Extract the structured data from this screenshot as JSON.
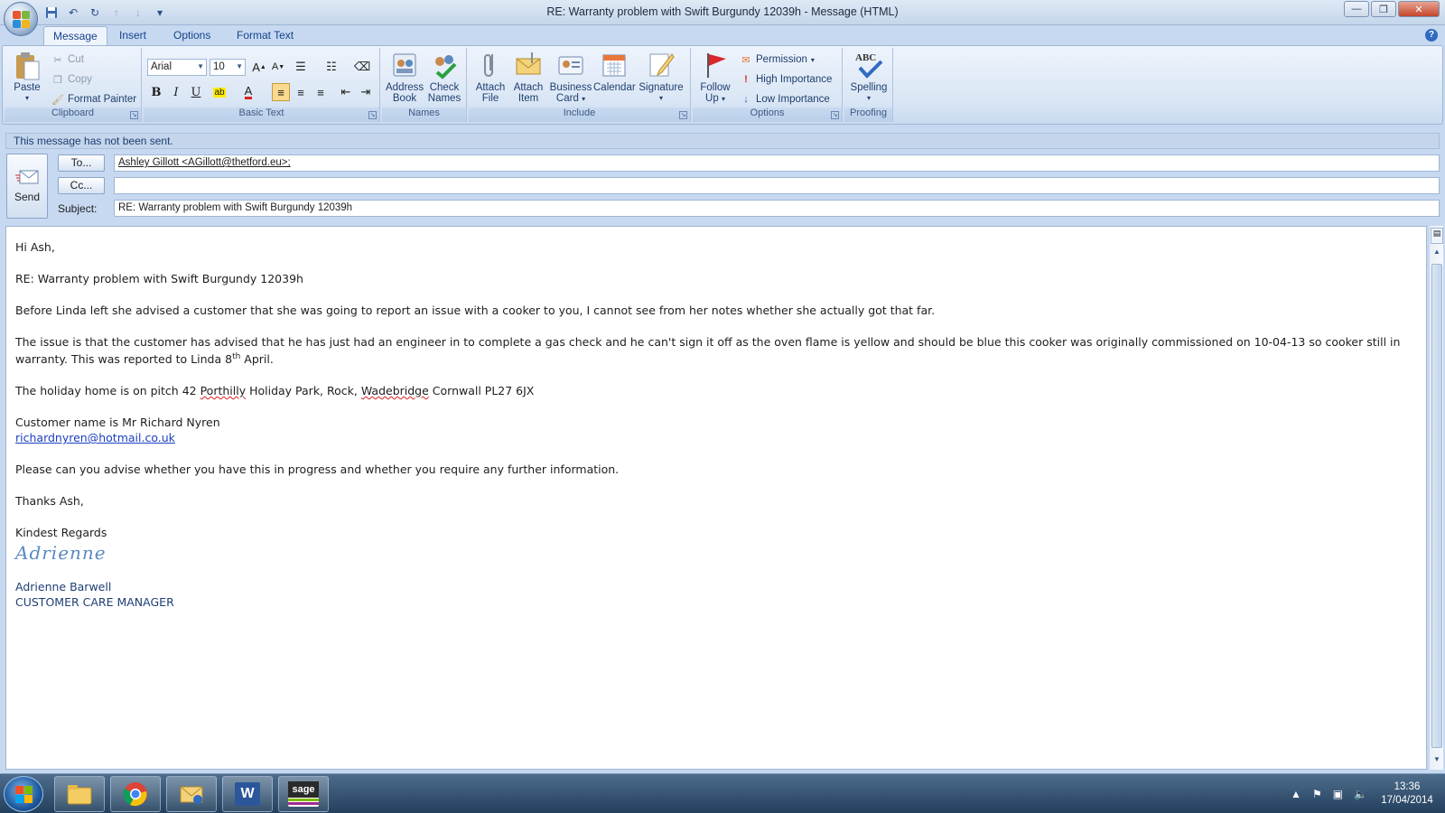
{
  "window": {
    "title": "RE: Warranty problem with Swift Burgundy 12039h - Message (HTML)",
    "controls": [
      "minimize-icon",
      "restore-icon",
      "close-icon"
    ]
  },
  "quick_access": [
    "save-icon",
    "undo-icon",
    "redo-icon",
    "up-icon",
    "down-icon",
    "customize-icon"
  ],
  "tabs": [
    {
      "label": "Message",
      "active": true
    },
    {
      "label": "Insert",
      "active": false
    },
    {
      "label": "Options",
      "active": false
    },
    {
      "label": "Format Text",
      "active": false
    }
  ],
  "ribbon": {
    "clipboard": {
      "label": "Clipboard",
      "paste": "Paste",
      "cut": "Cut",
      "copy": "Copy",
      "format_painter": "Format Painter"
    },
    "basic_text": {
      "label": "Basic Text",
      "font": "Arial",
      "size": "10"
    },
    "names": {
      "label": "Names",
      "address_book": [
        "Address",
        "Book"
      ],
      "check_names": [
        "Check",
        "Names"
      ]
    },
    "include": {
      "label": "Include",
      "attach_file": [
        "Attach",
        "File"
      ],
      "attach_item": [
        "Attach",
        "Item"
      ],
      "business_card": [
        "Business",
        "Card"
      ],
      "calendar": "Calendar",
      "signature": "Signature"
    },
    "options": {
      "label": "Options",
      "follow_up": [
        "Follow",
        "Up"
      ],
      "permission": "Permission",
      "high_importance": "High Importance",
      "low_importance": "Low Importance"
    },
    "proofing": {
      "label": "Proofing",
      "spelling": "Spelling",
      "abc": "ABC"
    }
  },
  "info_bar": "This message has not been sent.",
  "header": {
    "send": "Send",
    "to_button": "To...",
    "cc_button": "Cc...",
    "subject_label": "Subject:",
    "to_value": "Ashley Gillott <AGillott@thetford.eu>;",
    "cc_value": "",
    "subject_value": "RE: Warranty problem with Swift Burgundy 12039h"
  },
  "body": {
    "greeting": "Hi Ash,",
    "subject_line": "RE: Warranty problem with Swift Burgundy 12039h",
    "para1": "Before Linda left she advised a customer that she was going to report an issue with a cooker to you, I cannot see from her notes whether she actually got that far.",
    "para2_a": "The issue is that the customer has advised that he has just had an engineer in to complete a gas check and he can't sign it off as the oven flame is yellow and should be blue this cooker was originally commissioned on 10-04-13 so cooker still in warranty.  This was reported to Linda 8",
    "para2_sup": "th",
    "para2_b": " April.",
    "address_a": "The holiday home is on pitch 42 ",
    "address_porthilly": "Porthilly",
    "address_b": " Holiday Park, Rock, ",
    "address_wadebridge": "Wadebridge",
    "address_c": " Cornwall PL27 6JX",
    "customer_name": "Customer name is Mr Richard Nyren",
    "customer_email": "richardnyren@hotmail.co.uk",
    "request": "Please can you advise whether you have this in progress and whether you require any further information.",
    "thanks": "Thanks Ash,",
    "regards": "Kindest Regards",
    "signature_script": "Adrienne",
    "sig_name": "Adrienne Barwell",
    "sig_title": "CUSTOMER CARE MANAGER"
  },
  "taskbar": {
    "apps": [
      "explorer-icon",
      "chrome-icon",
      "outlook-icon",
      "word-icon",
      "sage-icon"
    ],
    "sage_label": "sage",
    "word_label": "W",
    "time": "13:36",
    "date": "17/04/2014"
  },
  "colors": {
    "ribbon_bg": "#dae6f5",
    "accent": "#15428b",
    "link": "#1a3fc0",
    "signature": "#5b8ac0"
  }
}
